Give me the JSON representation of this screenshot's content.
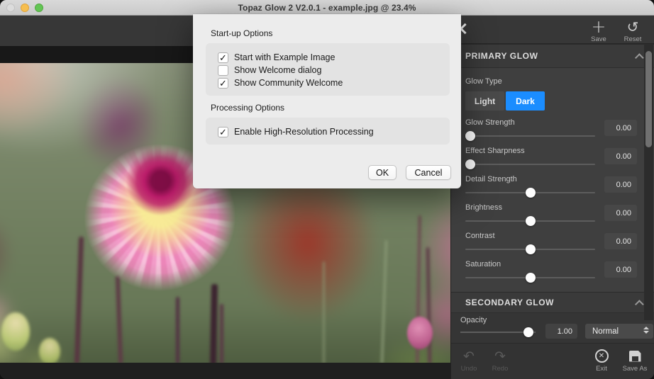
{
  "titlebar": {
    "title": "Topaz Glow 2 V2.0.1 - example.jpg @ 23.4%"
  },
  "dialog": {
    "startup_section_label": "Start-up Options",
    "startup_options": [
      {
        "label": "Start with Example Image",
        "checked": true
      },
      {
        "label": "Show Welcome dialog",
        "checked": false
      },
      {
        "label": "Show Community Welcome",
        "checked": true
      }
    ],
    "processing_section_label": "Processing Options",
    "processing_options": [
      {
        "label": "Enable High-Resolution Processing",
        "checked": true
      }
    ],
    "ok_label": "OK",
    "cancel_label": "Cancel"
  },
  "toolbar": {
    "save_label": "Save",
    "reset_label": "Reset"
  },
  "primary_glow": {
    "title": "PRIMARY GLOW",
    "glow_type_label": "Glow Type",
    "glow_type_options": [
      "Light",
      "Dark"
    ],
    "glow_type_selected": "Dark",
    "sliders": [
      {
        "label": "Glow Strength",
        "value": "0.00",
        "percent": 4
      },
      {
        "label": "Effect Sharpness",
        "value": "0.00",
        "percent": 4
      },
      {
        "label": "Detail Strength",
        "value": "0.00",
        "percent": 50
      },
      {
        "label": "Brightness",
        "value": "0.00",
        "percent": 50
      },
      {
        "label": "Contrast",
        "value": "0.00",
        "percent": 50
      },
      {
        "label": "Saturation",
        "value": "0.00",
        "percent": 50
      }
    ]
  },
  "secondary_glow": {
    "title": "SECONDARY GLOW",
    "opacity_label": "Opacity",
    "opacity_value": "1.00",
    "opacity_percent": 91,
    "blend_mode": "Normal"
  },
  "footer": {
    "undo_label": "Undo",
    "redo_label": "Redo",
    "exit_label": "Exit",
    "save_as_label": "Save As"
  },
  "colors": {
    "accent_blue": "#1b8dff",
    "traffic_yellow": "#f6be4f",
    "traffic_green": "#62c554"
  }
}
